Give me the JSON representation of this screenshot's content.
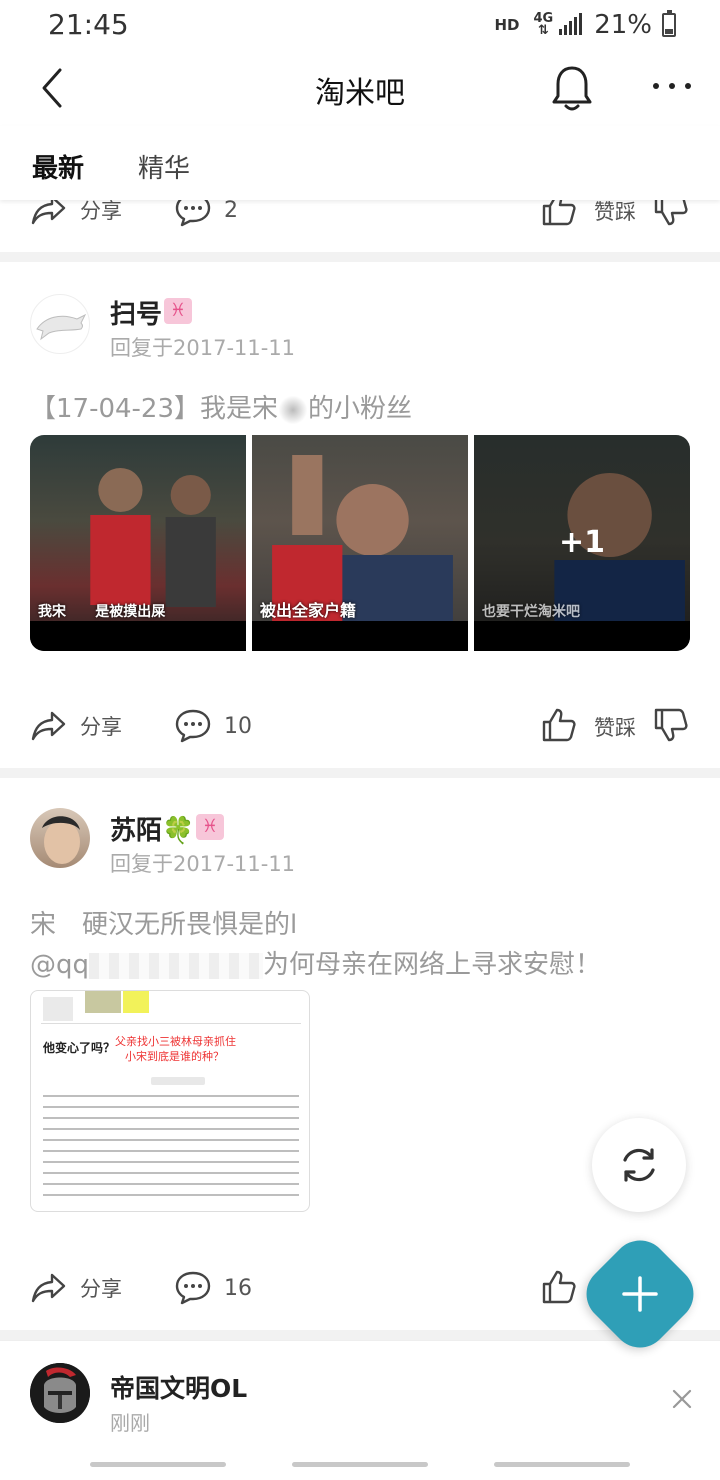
{
  "status_bar": {
    "time": "21:45",
    "hd": "HD",
    "network": "4G",
    "battery": "21%"
  },
  "nav": {
    "title": "淘米吧",
    "back_icon": "back-arrow-icon",
    "bell_icon": "bell-icon",
    "more_icon": "more-icon"
  },
  "tabs": [
    {
      "label": "最新",
      "active": true
    },
    {
      "label": "精华",
      "active": false
    }
  ],
  "top_actions": {
    "share": "分享",
    "comments": "2",
    "vote": "赞踩"
  },
  "posts": [
    {
      "author": "扫号",
      "zodiac": "♓",
      "reply_time": "回复于2017-11-11",
      "text_a": "【17-04-23】我是宋",
      "text_b": "的小粉丝",
      "images": [
        {
          "caption_a": "我宋",
          "caption_b": "是被摸出屎"
        },
        {
          "caption": "被出全家户籍"
        },
        {
          "caption": "也要干烂淘米吧",
          "overlay": "+1"
        }
      ],
      "actions": {
        "share": "分享",
        "comments": "10",
        "vote": "赞踩"
      }
    },
    {
      "author": "苏陌🍀",
      "zodiac": "♓",
      "reply_time": "回复于2017-11-11",
      "text_line1": "宋　硬汉无所畏惧是的l",
      "text_line2_a": "@qq",
      "text_line2_b": "为何母亲在网络上寻求安慰！",
      "doc": {
        "heading": "他变心了吗？",
        "red_line1": "父亲找小三被林母亲抓住",
        "red_line2": "小宋到底是谁的种？"
      },
      "actions": {
        "share": "分享",
        "comments": "16"
      }
    }
  ],
  "notification": {
    "name": "帝国文明OL",
    "time": "刚刚"
  }
}
